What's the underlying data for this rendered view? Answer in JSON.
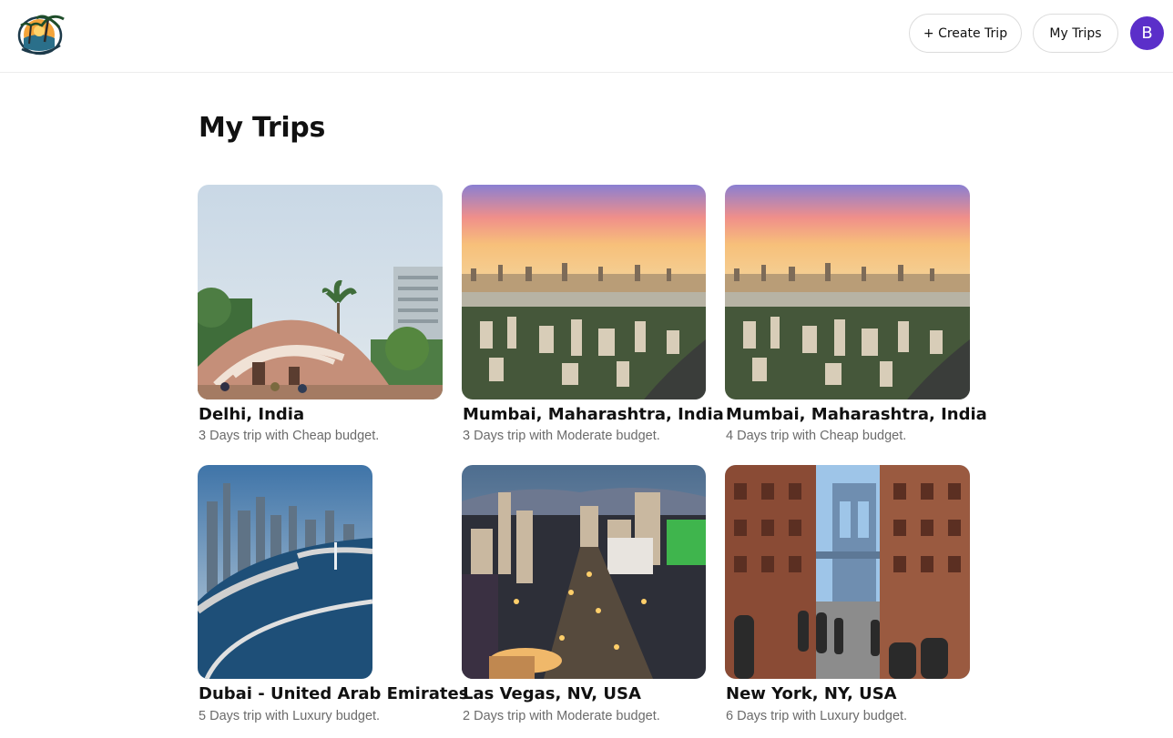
{
  "header": {
    "create_trip_label": "+ Create Trip",
    "my_trips_label": "My Trips",
    "avatar_initial": "B",
    "avatar_color": "#5b2fc9"
  },
  "page": {
    "title": "My Trips"
  },
  "trips": [
    {
      "name": "Delhi, India",
      "description": "3 Days trip with Cheap budget.",
      "image": "delhi-jantar-mantar-photo"
    },
    {
      "name": "Mumbai, Maharashtra, India",
      "description": "3 Days trip with Moderate budget.",
      "image": "mumbai-skyline-sunset-photo"
    },
    {
      "name": "Mumbai, Maharashtra, India",
      "description": "4 Days trip with Cheap budget.",
      "image": "mumbai-skyline-sunset-photo"
    },
    {
      "name": "Dubai - United Arab Emirates",
      "description": "5 Days trip with Luxury budget.",
      "image": "dubai-marina-aerial-photo"
    },
    {
      "name": "Las Vegas, NV, USA",
      "description": "2 Days trip with Moderate budget.",
      "image": "las-vegas-strip-night-photo"
    },
    {
      "name": "New York, NY, USA",
      "description": "6 Days trip with Luxury budget.",
      "image": "new-york-dumbo-bridge-photo"
    }
  ]
}
